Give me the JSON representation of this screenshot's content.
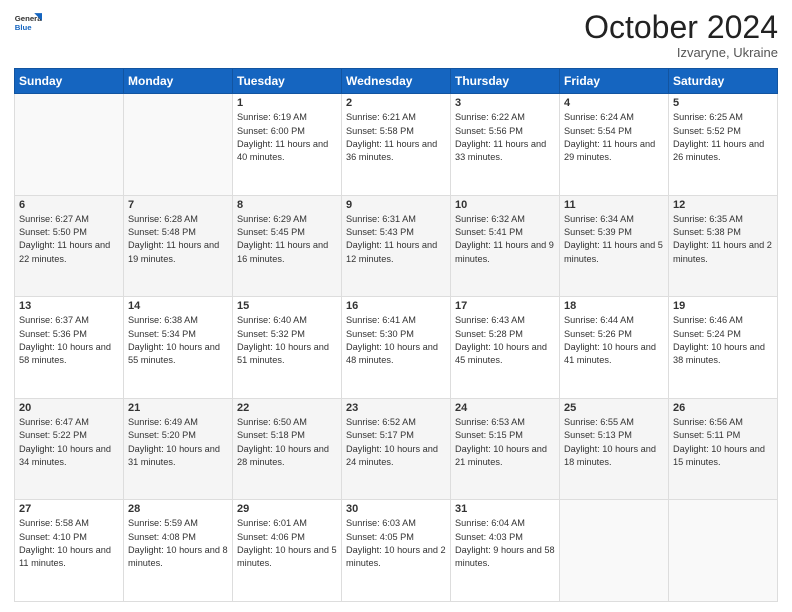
{
  "header": {
    "logo": {
      "general": "General",
      "blue": "Blue"
    },
    "month": "October 2024",
    "location": "Izvaryne, Ukraine"
  },
  "weekdays": [
    "Sunday",
    "Monday",
    "Tuesday",
    "Wednesday",
    "Thursday",
    "Friday",
    "Saturday"
  ],
  "weeks": [
    [
      {
        "day": null,
        "info": null
      },
      {
        "day": null,
        "info": null
      },
      {
        "day": "1",
        "info": "Sunrise: 6:19 AM\nSunset: 6:00 PM\nDaylight: 11 hours and 40 minutes."
      },
      {
        "day": "2",
        "info": "Sunrise: 6:21 AM\nSunset: 5:58 PM\nDaylight: 11 hours and 36 minutes."
      },
      {
        "day": "3",
        "info": "Sunrise: 6:22 AM\nSunset: 5:56 PM\nDaylight: 11 hours and 33 minutes."
      },
      {
        "day": "4",
        "info": "Sunrise: 6:24 AM\nSunset: 5:54 PM\nDaylight: 11 hours and 29 minutes."
      },
      {
        "day": "5",
        "info": "Sunrise: 6:25 AM\nSunset: 5:52 PM\nDaylight: 11 hours and 26 minutes."
      }
    ],
    [
      {
        "day": "6",
        "info": "Sunrise: 6:27 AM\nSunset: 5:50 PM\nDaylight: 11 hours and 22 minutes."
      },
      {
        "day": "7",
        "info": "Sunrise: 6:28 AM\nSunset: 5:48 PM\nDaylight: 11 hours and 19 minutes."
      },
      {
        "day": "8",
        "info": "Sunrise: 6:29 AM\nSunset: 5:45 PM\nDaylight: 11 hours and 16 minutes."
      },
      {
        "day": "9",
        "info": "Sunrise: 6:31 AM\nSunset: 5:43 PM\nDaylight: 11 hours and 12 minutes."
      },
      {
        "day": "10",
        "info": "Sunrise: 6:32 AM\nSunset: 5:41 PM\nDaylight: 11 hours and 9 minutes."
      },
      {
        "day": "11",
        "info": "Sunrise: 6:34 AM\nSunset: 5:39 PM\nDaylight: 11 hours and 5 minutes."
      },
      {
        "day": "12",
        "info": "Sunrise: 6:35 AM\nSunset: 5:38 PM\nDaylight: 11 hours and 2 minutes."
      }
    ],
    [
      {
        "day": "13",
        "info": "Sunrise: 6:37 AM\nSunset: 5:36 PM\nDaylight: 10 hours and 58 minutes."
      },
      {
        "day": "14",
        "info": "Sunrise: 6:38 AM\nSunset: 5:34 PM\nDaylight: 10 hours and 55 minutes."
      },
      {
        "day": "15",
        "info": "Sunrise: 6:40 AM\nSunset: 5:32 PM\nDaylight: 10 hours and 51 minutes."
      },
      {
        "day": "16",
        "info": "Sunrise: 6:41 AM\nSunset: 5:30 PM\nDaylight: 10 hours and 48 minutes."
      },
      {
        "day": "17",
        "info": "Sunrise: 6:43 AM\nSunset: 5:28 PM\nDaylight: 10 hours and 45 minutes."
      },
      {
        "day": "18",
        "info": "Sunrise: 6:44 AM\nSunset: 5:26 PM\nDaylight: 10 hours and 41 minutes."
      },
      {
        "day": "19",
        "info": "Sunrise: 6:46 AM\nSunset: 5:24 PM\nDaylight: 10 hours and 38 minutes."
      }
    ],
    [
      {
        "day": "20",
        "info": "Sunrise: 6:47 AM\nSunset: 5:22 PM\nDaylight: 10 hours and 34 minutes."
      },
      {
        "day": "21",
        "info": "Sunrise: 6:49 AM\nSunset: 5:20 PM\nDaylight: 10 hours and 31 minutes."
      },
      {
        "day": "22",
        "info": "Sunrise: 6:50 AM\nSunset: 5:18 PM\nDaylight: 10 hours and 28 minutes."
      },
      {
        "day": "23",
        "info": "Sunrise: 6:52 AM\nSunset: 5:17 PM\nDaylight: 10 hours and 24 minutes."
      },
      {
        "day": "24",
        "info": "Sunrise: 6:53 AM\nSunset: 5:15 PM\nDaylight: 10 hours and 21 minutes."
      },
      {
        "day": "25",
        "info": "Sunrise: 6:55 AM\nSunset: 5:13 PM\nDaylight: 10 hours and 18 minutes."
      },
      {
        "day": "26",
        "info": "Sunrise: 6:56 AM\nSunset: 5:11 PM\nDaylight: 10 hours and 15 minutes."
      }
    ],
    [
      {
        "day": "27",
        "info": "Sunrise: 5:58 AM\nSunset: 4:10 PM\nDaylight: 10 hours and 11 minutes."
      },
      {
        "day": "28",
        "info": "Sunrise: 5:59 AM\nSunset: 4:08 PM\nDaylight: 10 hours and 8 minutes."
      },
      {
        "day": "29",
        "info": "Sunrise: 6:01 AM\nSunset: 4:06 PM\nDaylight: 10 hours and 5 minutes."
      },
      {
        "day": "30",
        "info": "Sunrise: 6:03 AM\nSunset: 4:05 PM\nDaylight: 10 hours and 2 minutes."
      },
      {
        "day": "31",
        "info": "Sunrise: 6:04 AM\nSunset: 4:03 PM\nDaylight: 9 hours and 58 minutes."
      },
      {
        "day": null,
        "info": null
      },
      {
        "day": null,
        "info": null
      }
    ]
  ]
}
